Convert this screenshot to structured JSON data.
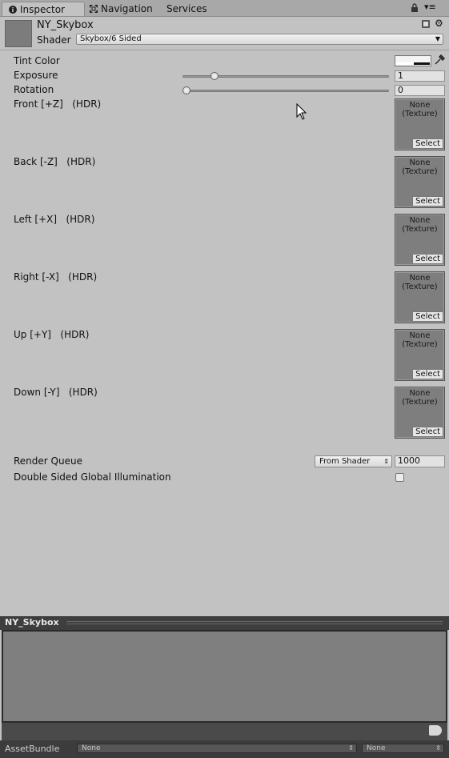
{
  "tabs": [
    {
      "label": "Inspector",
      "active": true,
      "icon": "info-icon"
    },
    {
      "label": "Navigation",
      "active": false,
      "icon": "navigation-icon"
    },
    {
      "label": "Services",
      "active": false
    }
  ],
  "header": {
    "material_name": "NY_Skybox",
    "shader_label": "Shader",
    "shader_value": "Skybox/6 Sided"
  },
  "properties": {
    "tint_color": {
      "label": "Tint Color"
    },
    "exposure": {
      "label": "Exposure",
      "value": "1",
      "slider_fraction": 0.14
    },
    "rotation": {
      "label": "Rotation",
      "value": "0",
      "slider_fraction": 0.0
    }
  },
  "textures": [
    {
      "label": "Front [+Z]   (HDR)",
      "none_text": "None",
      "type_text": "(Texture)",
      "select_label": "Select"
    },
    {
      "label": "Back [-Z]   (HDR)",
      "none_text": "None",
      "type_text": "(Texture)",
      "select_label": "Select"
    },
    {
      "label": "Left [+X]   (HDR)",
      "none_text": "None",
      "type_text": "(Texture)",
      "select_label": "Select"
    },
    {
      "label": "Right [-X]   (HDR)",
      "none_text": "None",
      "type_text": "(Texture)",
      "select_label": "Select"
    },
    {
      "label": "Up [+Y]   (HDR)",
      "none_text": "None",
      "type_text": "(Texture)",
      "select_label": "Select"
    },
    {
      "label": "Down [-Y]   (HDR)",
      "none_text": "None",
      "type_text": "(Texture)",
      "select_label": "Select"
    }
  ],
  "render_queue": {
    "label": "Render Queue",
    "mode": "From Shader",
    "value": "1000"
  },
  "double_sided_gi": {
    "label": "Double Sided Global Illumination",
    "checked": false
  },
  "preview": {
    "title": "NY_Skybox"
  },
  "asset_bundle": {
    "label": "AssetBundle",
    "name_value": "None",
    "variant_value": "None"
  },
  "colors": {
    "panel": "#c2c2c2",
    "preview": "#7f7f7f",
    "preview_bar": "#3e3e3e"
  }
}
